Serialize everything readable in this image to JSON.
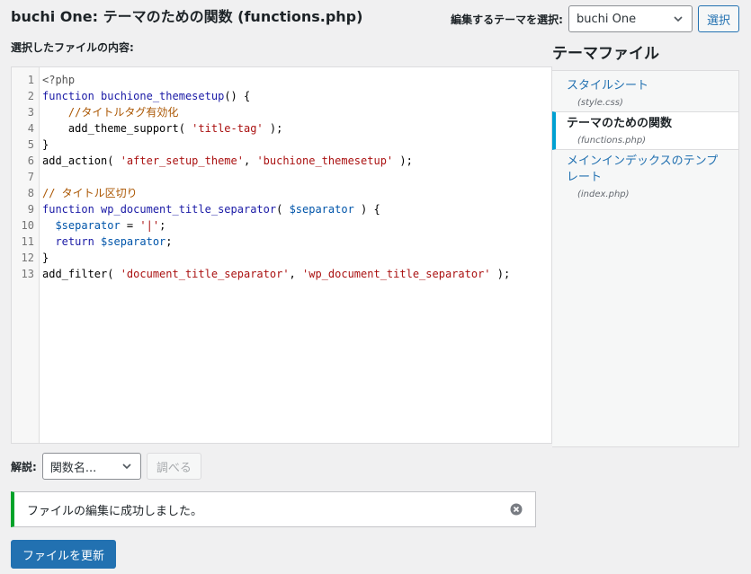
{
  "header": {
    "title": "buchi One: テーマのための関数 (functions.php)",
    "theme_select_label": "編集するテーマを選択:",
    "theme_select_value": "buchi One",
    "select_button": "選択"
  },
  "editor": {
    "label": "選択したファイルの内容:",
    "line_numbers": [
      "1",
      "2",
      "3",
      "4",
      "5",
      "6",
      "7",
      "8",
      "9",
      "10",
      "11",
      "12",
      "13"
    ],
    "lines": [
      [
        {
          "c": "phptag",
          "t": "<?php"
        }
      ],
      [
        {
          "c": "kw",
          "t": "function "
        },
        {
          "c": "fn",
          "t": "buchione_themesetup"
        },
        {
          "c": "plain",
          "t": "() {"
        }
      ],
      [
        {
          "c": "plain",
          "t": "    "
        },
        {
          "c": "cmt",
          "t": "//タイトルタグ有効化"
        }
      ],
      [
        {
          "c": "plain",
          "t": "    add_theme_support( "
        },
        {
          "c": "str",
          "t": "'title-tag'"
        },
        {
          "c": "plain",
          "t": " );"
        }
      ],
      [
        {
          "c": "plain",
          "t": "}"
        }
      ],
      [
        {
          "c": "plain",
          "t": "add_action( "
        },
        {
          "c": "str",
          "t": "'after_setup_theme'"
        },
        {
          "c": "plain",
          "t": ", "
        },
        {
          "c": "str",
          "t": "'buchione_themesetup'"
        },
        {
          "c": "plain",
          "t": " );"
        }
      ],
      [
        {
          "c": "plain",
          "t": ""
        }
      ],
      [
        {
          "c": "cmt",
          "t": "// タイトル区切り"
        }
      ],
      [
        {
          "c": "kw",
          "t": "function "
        },
        {
          "c": "fn",
          "t": "wp_document_title_separator"
        },
        {
          "c": "plain",
          "t": "( "
        },
        {
          "c": "var",
          "t": "$separator"
        },
        {
          "c": "plain",
          "t": " ) {"
        }
      ],
      [
        {
          "c": "plain",
          "t": "  "
        },
        {
          "c": "var",
          "t": "$separator"
        },
        {
          "c": "plain",
          "t": " = "
        },
        {
          "c": "str",
          "t": "'|'"
        },
        {
          "c": "plain",
          "t": ";"
        }
      ],
      [
        {
          "c": "plain",
          "t": "  "
        },
        {
          "c": "kw",
          "t": "return "
        },
        {
          "c": "var",
          "t": "$separator"
        },
        {
          "c": "plain",
          "t": ";"
        }
      ],
      [
        {
          "c": "plain",
          "t": "}"
        }
      ],
      [
        {
          "c": "plain",
          "t": "add_filter( "
        },
        {
          "c": "str",
          "t": "'document_title_separator'"
        },
        {
          "c": "plain",
          "t": ", "
        },
        {
          "c": "str",
          "t": "'wp_document_title_separator'"
        },
        {
          "c": "plain",
          "t": " );"
        }
      ]
    ]
  },
  "files": {
    "title": "テーマファイル",
    "items": [
      {
        "name": "スタイルシート",
        "file": "(style.css)"
      },
      {
        "name": "テーマのための関数",
        "file": "(functions.php)"
      },
      {
        "name": "メインインデックスのテンプレート",
        "file": "(index.php)"
      }
    ]
  },
  "documentation": {
    "label": "解説:",
    "select_value": "関数名...",
    "lookup_button": "調べる"
  },
  "notice": {
    "message": "ファイルの編集に成功しました。",
    "dismiss_icon": "close-circle-icon"
  },
  "actions": {
    "update_button": "ファイルを更新"
  },
  "colors": {
    "primary": "#2271b1",
    "success": "#00a32a",
    "active_file_border": "#00a0d2"
  }
}
